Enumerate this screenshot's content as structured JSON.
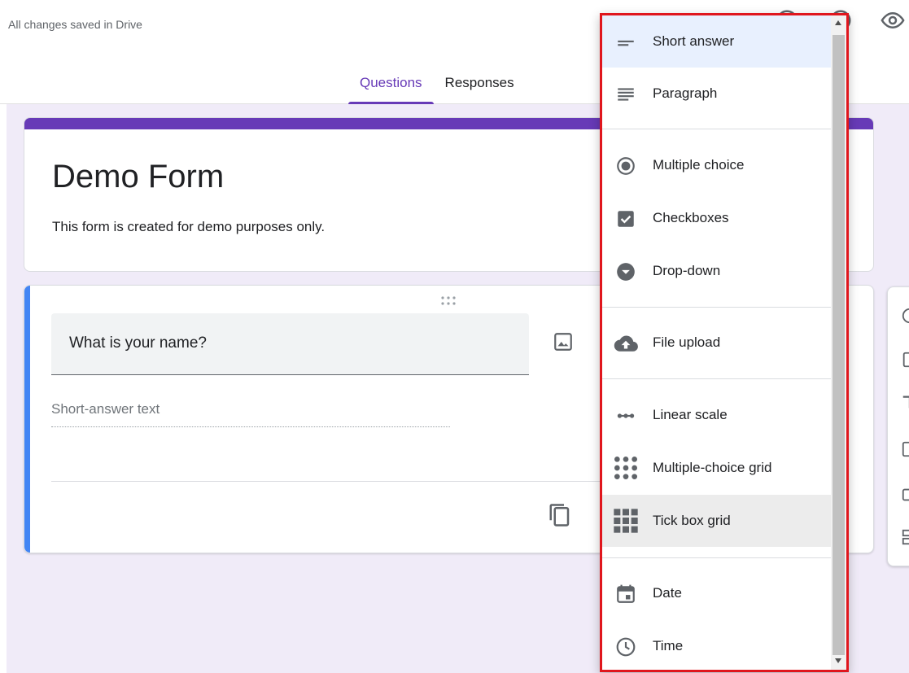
{
  "header": {
    "saved_status": "All changes saved in Drive",
    "icons": [
      "palette-icon",
      "help-icon",
      "preview-eye-icon"
    ]
  },
  "tabs": [
    {
      "label": "Questions",
      "active": true
    },
    {
      "label": "Responses",
      "active": false
    }
  ],
  "form": {
    "title": "Demo Form",
    "description": "This form is created for demo purposes only."
  },
  "question": {
    "title": "What is your name?",
    "answer_placeholder": "Short-answer text"
  },
  "question_type_menu": {
    "items": [
      {
        "label": "Short answer",
        "icon": "short-answer-icon",
        "selected": true
      },
      {
        "label": "Paragraph",
        "icon": "paragraph-icon"
      },
      {
        "label": "Multiple choice",
        "icon": "radio-button-icon"
      },
      {
        "label": "Checkboxes",
        "icon": "checkbox-icon"
      },
      {
        "label": "Drop-down",
        "icon": "dropdown-circle-icon"
      },
      {
        "label": "File upload",
        "icon": "cloud-upload-icon"
      },
      {
        "label": "Linear scale",
        "icon": "linear-scale-icon"
      },
      {
        "label": "Multiple-choice grid",
        "icon": "dot-grid-icon"
      },
      {
        "label": "Tick box grid",
        "icon": "tick-grid-icon",
        "hovered": true
      },
      {
        "label": "Date",
        "icon": "calendar-icon"
      },
      {
        "label": "Time",
        "icon": "clock-icon"
      }
    ]
  },
  "colors": {
    "accent": "#673ab7",
    "question_accent": "#4285f4",
    "highlight_border": "#e0161d",
    "canvas": "#f0ebf8"
  }
}
